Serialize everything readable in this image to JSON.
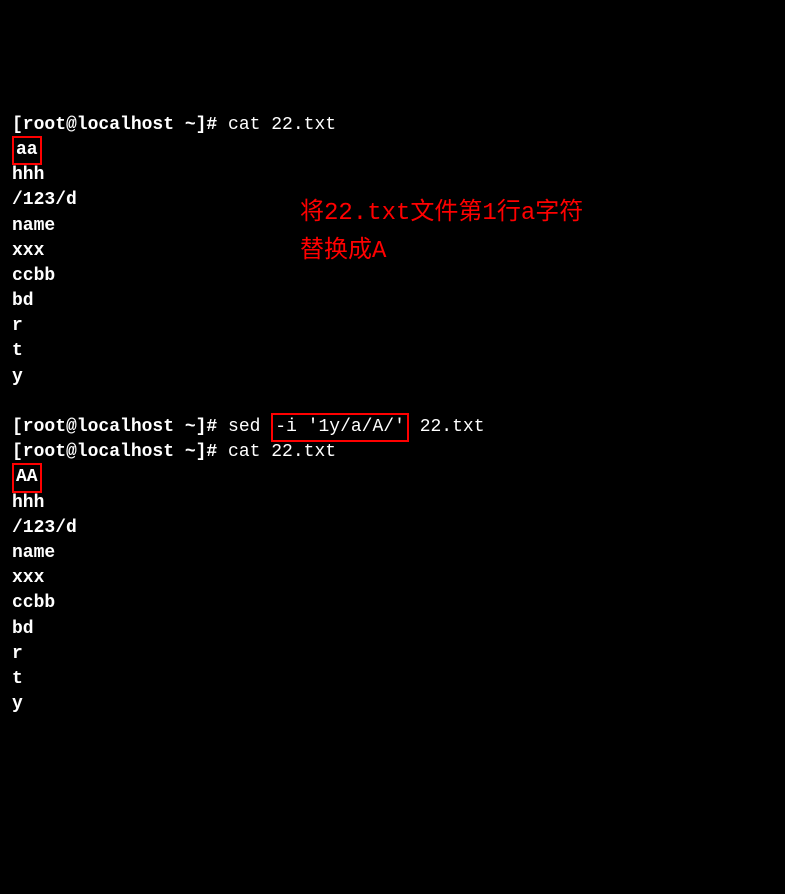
{
  "terminal": {
    "prompt1": "[root@localhost ~]# ",
    "cmd1": "cat 22.txt",
    "output1": {
      "line1": "aa",
      "line2": "hhh",
      "line3": "/123/d",
      "line4": "name",
      "line5": "xxx",
      "line6": "ccbb",
      "line7": "bd",
      "line8": "r",
      "line9": "t",
      "line10": "y"
    },
    "prompt2": "[root@localhost ~]# ",
    "cmd2_part1": "sed ",
    "cmd2_highlight": "-i '1y/a/A/'",
    "cmd2_part2": " 22.txt",
    "prompt3": "[root@localhost ~]# ",
    "cmd3": "cat 22.txt",
    "output2": {
      "line1": "AA",
      "line2": "hhh",
      "line3": "/123/d",
      "line4": "name",
      "line5": "xxx",
      "line6": "ccbb",
      "line7": "bd",
      "line8": "r",
      "line9": "t",
      "line10": "y"
    }
  },
  "annotation": {
    "text_line1": "将22.txt文件第1行a字符",
    "text_line2": "替换成A"
  }
}
